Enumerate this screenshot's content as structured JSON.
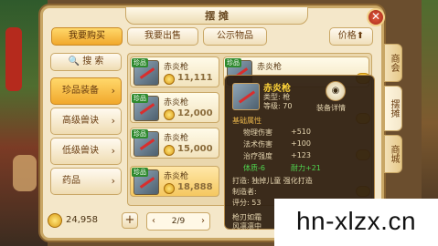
{
  "window": {
    "title": "摆 摊",
    "close_label": "✕"
  },
  "tabs": [
    {
      "label": "我要购买",
      "active": true
    },
    {
      "label": "我要出售",
      "active": false
    },
    {
      "label": "公示物品",
      "active": false
    }
  ],
  "sort": {
    "label": "价格⬆"
  },
  "search": {
    "label": "🔍 搜 索"
  },
  "categories": [
    {
      "label": "珍品装备",
      "active": true
    },
    {
      "label": "高级兽诀",
      "active": false
    },
    {
      "label": "低级兽诀",
      "active": false
    },
    {
      "label": "药品",
      "active": false
    }
  ],
  "items": [
    {
      "badge": "珍品",
      "name": "赤炎枪",
      "price": "11,111"
    },
    {
      "badge": "珍品",
      "name": "赤炎枪",
      "price": "12,000"
    },
    {
      "badge": "珍品",
      "name": "赤炎枪",
      "price": "15,000"
    },
    {
      "badge": "珍品",
      "name": "赤炎枪",
      "price": "18,888"
    },
    {
      "badge": "珍品",
      "name": "赤炎枪",
      "price": ""
    },
    {
      "badge": "珍品",
      "name": "赤炎枪",
      "price": ""
    }
  ],
  "footer": {
    "money": "24,958",
    "plus": "+",
    "page": "2/9"
  },
  "side_tabs": [
    {
      "label": "商会",
      "active": false
    },
    {
      "label": "摆摊",
      "active": true
    },
    {
      "label": "商城",
      "active": false
    }
  ],
  "popup": {
    "name": "赤炎枪",
    "type": "类型: 枪",
    "level": "等级: 70",
    "eye_label": "◉",
    "detail_label": "装备详情",
    "base_title": "基础属性",
    "attrs": [
      {
        "k": "物理伤害",
        "v": "+510"
      },
      {
        "k": "法术伤害",
        "v": "+100"
      },
      {
        "k": "治疗强度",
        "v": "+123"
      }
    ],
    "bonus_a": "体质-6",
    "bonus_b": "耐力+21",
    "forge": "打造: 独掉儿童  强化打造",
    "maker": "制造者:",
    "score": "评分: 53",
    "desc": "枪刃如霜",
    "desc2": "风凛凛中"
  },
  "watermark": "hn-xlzx.cn"
}
